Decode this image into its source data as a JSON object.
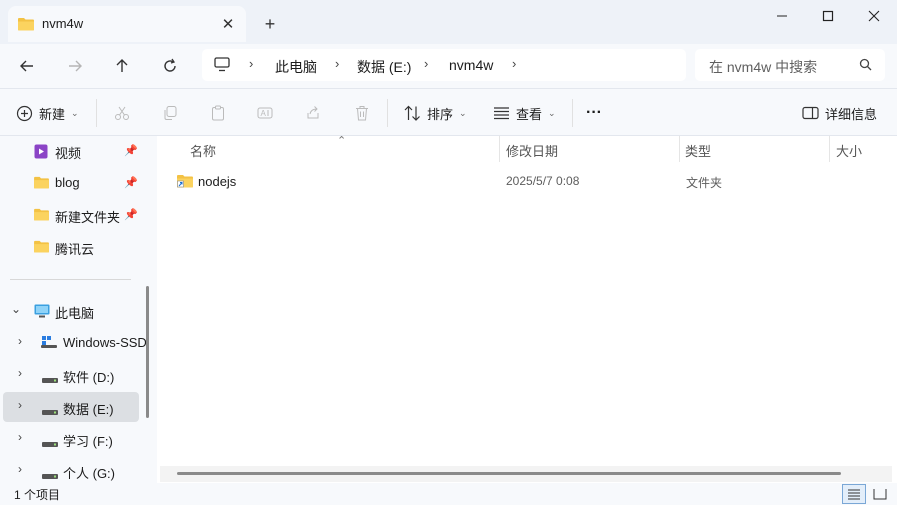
{
  "tab": {
    "title": "nvm4w",
    "close": "✕",
    "new": "+"
  },
  "window": {
    "minimize": "—",
    "maximize": "☐",
    "close": "✕"
  },
  "breadcrumb": [
    "此电脑",
    "数据 (E:)",
    "nvm4w"
  ],
  "search": {
    "placeholder": "在 nvm4w 中搜索"
  },
  "toolbar": {
    "new_label": "新建",
    "sort_label": "排序",
    "view_label": "查看",
    "more_label": "···",
    "details_label": "详细信息"
  },
  "sidebar": {
    "quick": [
      {
        "label": "视频",
        "icon": "video-icon",
        "pinned": true
      },
      {
        "label": "blog",
        "icon": "folder-icon",
        "pinned": true
      },
      {
        "label": "新建文件夹",
        "icon": "folder-icon",
        "pinned": true
      },
      {
        "label": "腾讯云",
        "icon": "folder-icon",
        "pinned": false
      }
    ],
    "pc_label": "此电脑",
    "drives": [
      {
        "label": "Windows-SSD",
        "icon": "windows-drive-icon"
      },
      {
        "label": "软件 (D:)",
        "icon": "drive-icon"
      },
      {
        "label": "数据 (E:)",
        "icon": "drive-icon",
        "selected": true
      },
      {
        "label": "学习 (F:)",
        "icon": "drive-icon"
      },
      {
        "label": "个人 (G:)",
        "icon": "drive-icon"
      }
    ]
  },
  "columns": {
    "name": "名称",
    "modified": "修改日期",
    "type": "类型",
    "size": "大小"
  },
  "files": [
    {
      "name": "nodejs",
      "modified": "2025/5/7 0:08",
      "type": "文件夹",
      "icon": "folder-shortcut-icon"
    }
  ],
  "status": {
    "item_count": "1 个项目"
  },
  "colors": {
    "accent": "#0067c0",
    "folder": "#f3c244",
    "background": "#eef2f8"
  }
}
